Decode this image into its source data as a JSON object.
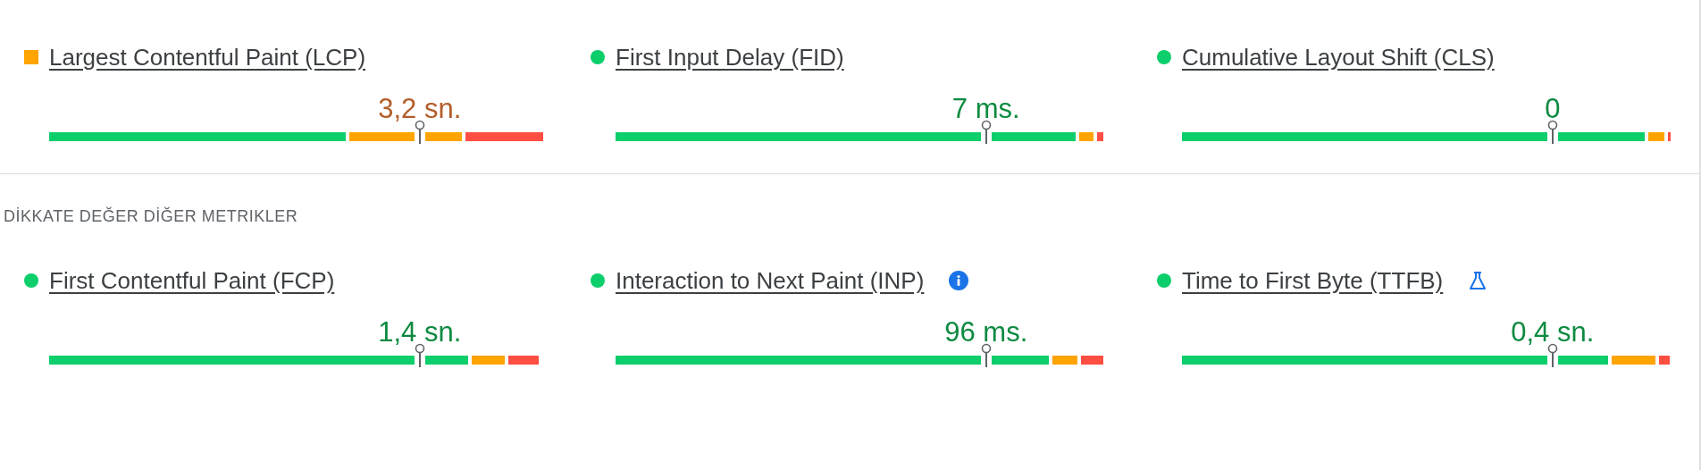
{
  "top_metrics": [
    {
      "title": "Largest Contentful Paint (LCP)",
      "kind": "ni",
      "value": "3,2 sn."
    },
    {
      "title": "First Input Delay (FID)",
      "kind": "good",
      "value": "7 ms."
    },
    {
      "title": "Cumulative Layout Shift (CLS)",
      "kind": "good",
      "value": "0"
    }
  ],
  "section_heading": "DİKKATE DEĞER DİĞER METRIKLER",
  "other_metrics": [
    {
      "title": "First Contentful Paint (FCP)",
      "kind": "good",
      "value": "1,4 sn."
    },
    {
      "title": "Interaction to Next Paint (INP)",
      "kind": "good",
      "value": "96 ms.",
      "badge": {
        "kind": "info"
      }
    },
    {
      "title": "Time to First Byte (TTFB)",
      "kind": "good",
      "value": "0,4 sn.",
      "badge": {
        "kind": "lab"
      }
    }
  ]
}
